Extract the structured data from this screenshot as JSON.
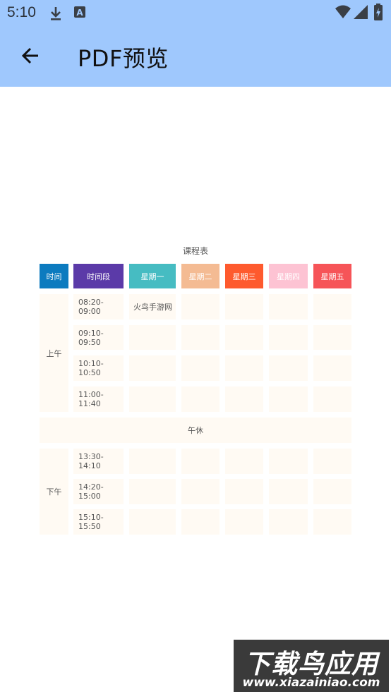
{
  "status_bar": {
    "time": "5:10",
    "icons": [
      "download-icon",
      "a-badge-icon",
      "wifi-icon",
      "signal-icon",
      "battery-icon"
    ]
  },
  "app_bar": {
    "title": "PDF预览",
    "back_icon": "arrow-left-icon",
    "background": "#9fc8fd"
  },
  "document": {
    "table_title": "课程表",
    "headers": [
      {
        "label": "时间",
        "color": "#0c7bbf"
      },
      {
        "label": "时间段",
        "color": "#5b3aa8"
      },
      {
        "label": "星期一",
        "color": "#46bcc2"
      },
      {
        "label": "星期二",
        "color": "#f4bb93"
      },
      {
        "label": "星期三",
        "color": "#fe5a2e"
      },
      {
        "label": "星期四",
        "color": "#fdc3d3"
      },
      {
        "label": "星期五",
        "color": "#f65458"
      }
    ],
    "morning_label": "上午",
    "afternoon_label": "下午",
    "lunch_label": "午休",
    "morning_rows": [
      {
        "slot": "08:20-09:00",
        "mon": "火鸟手游网"
      },
      {
        "slot": "09:10-09:50",
        "mon": ""
      },
      {
        "slot": "10:10-10:50",
        "mon": ""
      },
      {
        "slot": "11:00-11:40",
        "mon": ""
      }
    ],
    "afternoon_rows": [
      {
        "slot": "13:30-14:10",
        "mon": ""
      },
      {
        "slot": "14:20-15:00",
        "mon": ""
      },
      {
        "slot": "15:10-15:50",
        "mon": ""
      }
    ]
  },
  "watermark": {
    "title": "下载鸟应用",
    "url": "www.xiazainiao.com"
  }
}
